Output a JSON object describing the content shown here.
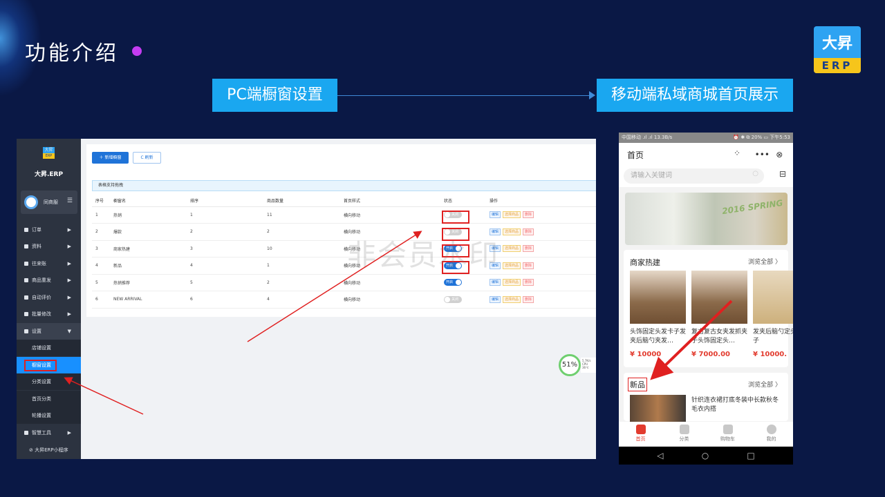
{
  "slide": {
    "title": "功能介绍",
    "logo_cn": "大昇",
    "logo_en": "ERP",
    "left_tag": "PC端橱窗设置",
    "right_tag": "移动端私域商城首页展示"
  },
  "pc": {
    "sidebar": {
      "logo_top": "大昇",
      "logo_bottom": "ERP",
      "brand": "大昇.ERP",
      "user_name": "同商服",
      "menu_icon": "☰",
      "items": [
        {
          "label": "订单",
          "arrow": "▶"
        },
        {
          "label": "资料",
          "arrow": "▶"
        },
        {
          "label": "往来账",
          "arrow": "▶"
        },
        {
          "label": "商品重发",
          "arrow": "▶"
        },
        {
          "label": "自动评价",
          "arrow": "▶"
        },
        {
          "label": "批量修改",
          "arrow": "▶"
        },
        {
          "label": "设置",
          "arrow": "▼"
        }
      ],
      "sub_items": [
        "店铺设置",
        "橱窗设置",
        "分类设置",
        "首页分类",
        "轮播设置"
      ],
      "tools": {
        "label": "智慧工具",
        "arrow": "▶"
      },
      "mini": "⊘ 大昇ERP小程序"
    },
    "toolbar": {
      "add_label": "＋ 新增橱窗",
      "refresh_label": "C 刷新"
    },
    "hint": "表格支持拖拽",
    "columns": [
      "序号",
      "橱窗名",
      "排序",
      "商品数量",
      "首页样式",
      "状态",
      "操作"
    ],
    "rows": [
      {
        "no": "1",
        "name": "热销",
        "sort": "1",
        "count": "11",
        "style": "横向移动",
        "status": "关闭"
      },
      {
        "no": "2",
        "name": "爆款",
        "sort": "2",
        "count": "2",
        "style": "横向移动",
        "status": "关闭"
      },
      {
        "no": "3",
        "name": "商家热建",
        "sort": "3",
        "count": "10",
        "style": "横向移动",
        "status": "开启"
      },
      {
        "no": "4",
        "name": "新品",
        "sort": "4",
        "count": "1",
        "style": "横向移动",
        "status": "开启"
      },
      {
        "no": "5",
        "name": "热销推荐",
        "sort": "5",
        "count": "2",
        "style": "横向移动",
        "status": "开启"
      },
      {
        "no": "6",
        "name": "NEW ARRIVAL",
        "sort": "6",
        "count": "4",
        "style": "横向移动",
        "status": "关闭"
      }
    ],
    "ops": [
      "编辑",
      "选择商品",
      "删除"
    ],
    "watermark": "非会员水印",
    "cpu": {
      "percent": "51%",
      "line1": "5.7K/s",
      "line2": "CPU 36℃"
    }
  },
  "mobile": {
    "status_left": "中国移动 .ıl .ıl 13.3B/s",
    "status_right": "⏰ ✱ ⧉ 20% ▭ 下午5:53",
    "title": "首页",
    "icons": {
      "qr": "⁘",
      "more": "•••",
      "close": "⊗"
    },
    "search_placeholder": "请输入关键词",
    "banner_text": "2016 SPRING",
    "section1": {
      "title": "商家热建",
      "more": "浏览全部 〉",
      "products": [
        {
          "name": "头饰固定头发卡子发夹后脑勺夹发…",
          "price": "¥ 10000"
        },
        {
          "name": "复古复古女夹发抓夹子头饰固定头…",
          "price": "¥ 7000.00"
        },
        {
          "name": "发夹后脑勺定头发卡子",
          "price": "¥ 10000."
        }
      ]
    },
    "section2": {
      "title": "新品",
      "more": "浏览全部 〉",
      "product_name": "针织连衣裙打底冬装中长款秋冬毛衣内搭"
    },
    "tabs": [
      "首页",
      "分类",
      "购物车",
      "我的"
    ],
    "nav": [
      "◁",
      "○",
      "□"
    ]
  }
}
